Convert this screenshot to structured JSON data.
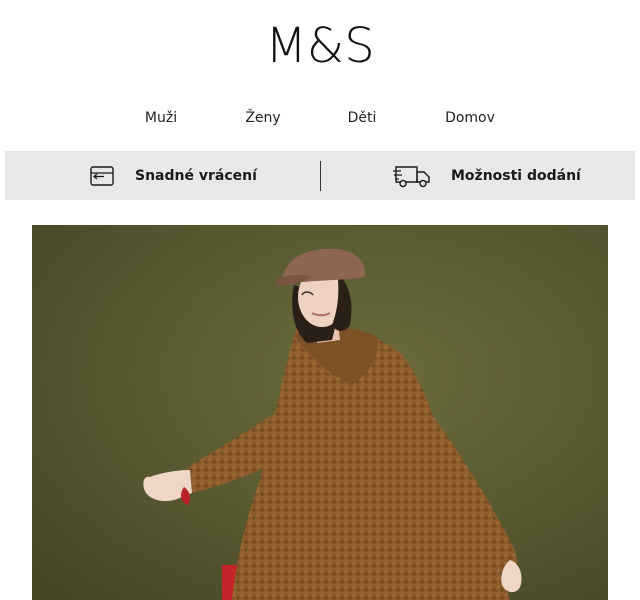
{
  "brand": {
    "logo_text": "M&S"
  },
  "nav": {
    "items": [
      {
        "label": "Muži"
      },
      {
        "label": "Ženy"
      },
      {
        "label": "Děti"
      },
      {
        "label": "Domov"
      }
    ]
  },
  "services": {
    "returns_label": "Snadné vrácení",
    "returns_icon": "return-tag-icon",
    "delivery_label": "Možnosti dodání",
    "delivery_icon": "delivery-truck-icon"
  },
  "hero": {
    "image_subject": "woman in brown teddy coat and brown cap",
    "colors": {
      "background": "#55562e",
      "coat": "#8a5a2b",
      "cap": "#8c6650",
      "trousers": "#c4242a"
    }
  }
}
